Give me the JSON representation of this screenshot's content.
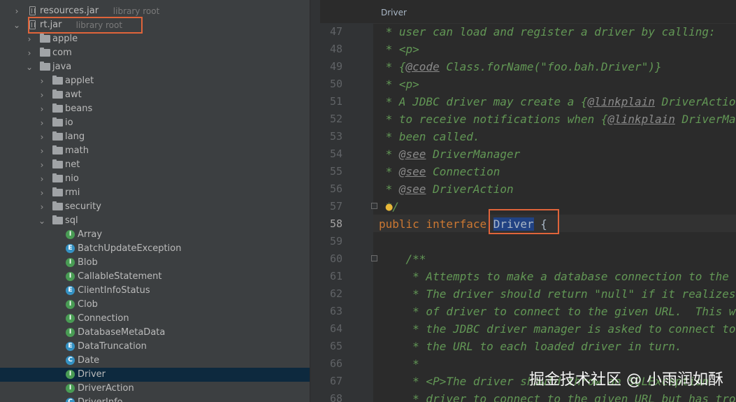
{
  "editor_tab": "Driver",
  "watermark": "掘金技术社区 @ 小雨润如酥",
  "tree": [
    {
      "type": "jar",
      "indent": 0,
      "expanded": false,
      "label": "resources.jar",
      "sub": "library root"
    },
    {
      "type": "jar",
      "indent": 0,
      "expanded": true,
      "label": "rt.jar",
      "sub": "library root",
      "boxed": true
    },
    {
      "type": "folder",
      "indent": 1,
      "expanded": false,
      "label": "apple"
    },
    {
      "type": "folder",
      "indent": 1,
      "expanded": false,
      "label": "com"
    },
    {
      "type": "folder",
      "indent": 1,
      "expanded": true,
      "label": "java"
    },
    {
      "type": "folder",
      "indent": 2,
      "expanded": false,
      "label": "applet"
    },
    {
      "type": "folder",
      "indent": 2,
      "expanded": false,
      "label": "awt"
    },
    {
      "type": "folder",
      "indent": 2,
      "expanded": false,
      "label": "beans"
    },
    {
      "type": "folder",
      "indent": 2,
      "expanded": false,
      "label": "io"
    },
    {
      "type": "folder",
      "indent": 2,
      "expanded": false,
      "label": "lang"
    },
    {
      "type": "folder",
      "indent": 2,
      "expanded": false,
      "label": "math"
    },
    {
      "type": "folder",
      "indent": 2,
      "expanded": false,
      "label": "net"
    },
    {
      "type": "folder",
      "indent": 2,
      "expanded": false,
      "label": "nio"
    },
    {
      "type": "folder",
      "indent": 2,
      "expanded": false,
      "label": "rmi"
    },
    {
      "type": "folder",
      "indent": 2,
      "expanded": false,
      "label": "security"
    },
    {
      "type": "folder",
      "indent": 2,
      "expanded": true,
      "label": "sql"
    },
    {
      "type": "class",
      "kind": "I",
      "color": "#499c54",
      "label": "Array"
    },
    {
      "type": "class",
      "kind": "E",
      "color": "#3592c4",
      "label": "BatchUpdateException",
      "exception": true
    },
    {
      "type": "class",
      "kind": "I",
      "color": "#499c54",
      "label": "Blob"
    },
    {
      "type": "class",
      "kind": "I",
      "color": "#499c54",
      "label": "CallableStatement"
    },
    {
      "type": "class",
      "kind": "E",
      "color": "#3592c4",
      "label": "ClientInfoStatus"
    },
    {
      "type": "class",
      "kind": "I",
      "color": "#499c54",
      "label": "Clob"
    },
    {
      "type": "class",
      "kind": "I",
      "color": "#499c54",
      "label": "Connection"
    },
    {
      "type": "class",
      "kind": "I",
      "color": "#499c54",
      "label": "DatabaseMetaData"
    },
    {
      "type": "class",
      "kind": "E",
      "color": "#3592c4",
      "label": "DataTruncation",
      "exception": true
    },
    {
      "type": "class",
      "kind": "C",
      "color": "#3592c4",
      "label": "Date"
    },
    {
      "type": "class",
      "kind": "I",
      "color": "#499c54",
      "label": "Driver",
      "selected": true
    },
    {
      "type": "class",
      "kind": "I",
      "color": "#499c54",
      "label": "DriverAction"
    },
    {
      "type": "class",
      "kind": "C",
      "color": "#3592c4",
      "label": "DriverInfo"
    }
  ],
  "code_lines": [
    {
      "n": "47",
      "text": " * user can load and register a driver by calling:"
    },
    {
      "n": "48",
      "text": " * <p>"
    },
    {
      "n": "49",
      "text": " * {@code Class.forName(\"foo.bah.Driver\")}"
    },
    {
      "n": "50",
      "text": " * <p>"
    },
    {
      "n": "51",
      "text": " * A JDBC driver may create a {@linkplain DriverAction"
    },
    {
      "n": "52",
      "text": " * to receive notifications when {@linkplain DriverMa"
    },
    {
      "n": "53",
      "text": " * been called."
    },
    {
      "n": "54",
      "text": " * @see DriverManager"
    },
    {
      "n": "55",
      "text": " * @see Connection"
    },
    {
      "n": "56",
      "text": " * @see DriverAction"
    },
    {
      "n": "57",
      "text": " */"
    },
    {
      "n": "58",
      "text": "public interface Driver {"
    },
    {
      "n": "59",
      "text": ""
    },
    {
      "n": "60",
      "text": "    /**"
    },
    {
      "n": "61",
      "text": "     * Attempts to make a database connection to the g"
    },
    {
      "n": "62",
      "text": "     * The driver should return \"null\" if it realizes"
    },
    {
      "n": "63",
      "text": "     * of driver to connect to the given URL.  This w"
    },
    {
      "n": "64",
      "text": "     * the JDBC driver manager is asked to connect to"
    },
    {
      "n": "65",
      "text": "     * the URL to each loaded driver in turn."
    },
    {
      "n": "66",
      "text": "     *"
    },
    {
      "n": "67",
      "text": "     * <P>The driver should throw an SQLException"
    },
    {
      "n": "68",
      "text": "     * driver to connect to the given URL but has tro"
    }
  ]
}
